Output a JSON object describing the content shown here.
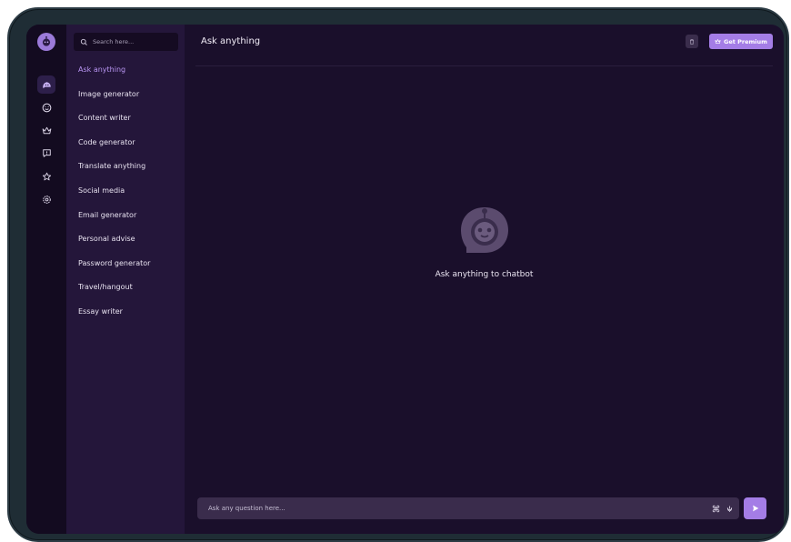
{
  "search": {
    "placeholder": "Search here..."
  },
  "sidebar": {
    "items": [
      {
        "label": "Ask anything",
        "active": true
      },
      {
        "label": "Image generator"
      },
      {
        "label": "Content writer"
      },
      {
        "label": "Code generator"
      },
      {
        "label": "Translate anything"
      },
      {
        "label": "Social media"
      },
      {
        "label": "Email generator"
      },
      {
        "label": "Personal advise"
      },
      {
        "label": "Password generator"
      },
      {
        "label": "Travel/hangout"
      },
      {
        "label": "Essay writer"
      }
    ]
  },
  "rail": {
    "icons": [
      "chatbot-icon",
      "emoji-icon",
      "crown-icon",
      "feedback-icon",
      "star-icon",
      "settings-icon"
    ]
  },
  "header": {
    "title": "Ask anything",
    "premium_label": "Get Premium"
  },
  "empty_state": {
    "label": "Ask anything to chatbot"
  },
  "composer": {
    "placeholder": "Ask any question here..."
  },
  "colors": {
    "accent": "#a47de6",
    "background": "#1a0f2b",
    "sidebar": "#24163a",
    "rail": "#130b20",
    "active_item": "#b895f2"
  }
}
